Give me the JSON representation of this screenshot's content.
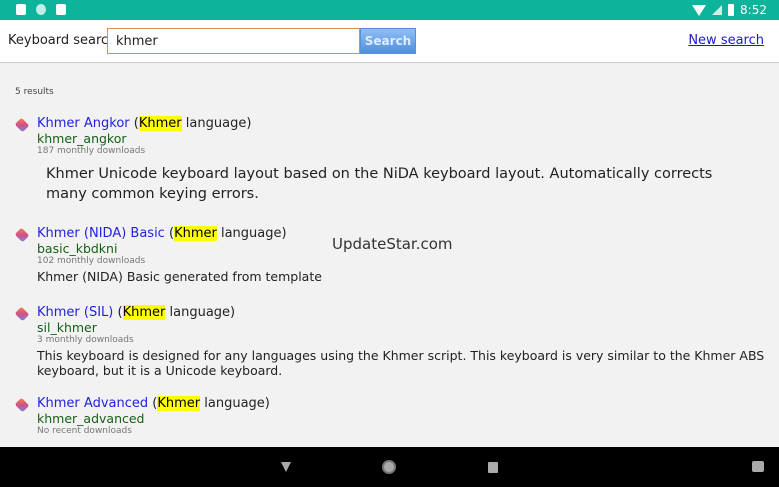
{
  "header": {
    "search_label": "Keyboard search:",
    "search_value": "khmer",
    "search_button": "Search",
    "new_search": "New search"
  },
  "status": {
    "time": "8:52"
  },
  "results_count": "5 results",
  "watermark": "UpdateStar.com",
  "results": [
    {
      "title": "Khmer Angkor",
      "lang_open": "(",
      "lang_hl": "Khmer",
      "lang_rest": " language)",
      "id": "khmer_angkor",
      "downloads": "187 monthly downloads",
      "desc": "Khmer Unicode keyboard layout based on the NiDA keyboard layout. Automatically corrects many common keying errors."
    },
    {
      "title": "Khmer (NIDA) Basic",
      "lang_open": "(",
      "lang_hl": "Khmer",
      "lang_rest": " language)",
      "id": "basic_kbdkni",
      "downloads": "102 monthly downloads",
      "desc": "Khmer (NIDA) Basic generated from template"
    },
    {
      "title": "Khmer (SIL)",
      "lang_open": "(",
      "lang_hl": "Khmer",
      "lang_rest": " language)",
      "id": "sil_khmer",
      "downloads": "3 monthly downloads",
      "desc": "This keyboard is designed for any languages using the Khmer script. This keyboard is very similar to the Khmer ABS keyboard, but it is a Unicode keyboard."
    },
    {
      "title": "Khmer Advanced",
      "lang_open": "(",
      "lang_hl": "Khmer",
      "lang_rest": " language)",
      "id": "khmer_advanced",
      "downloads": "No recent downloads"
    }
  ]
}
